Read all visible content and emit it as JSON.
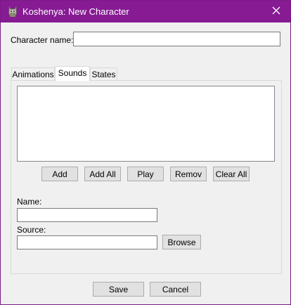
{
  "window": {
    "title": "Koshenya: New Character",
    "app_icon": "koshenya-cat-icon",
    "close_icon": "close-icon",
    "accent_color": "#861b93"
  },
  "character": {
    "name_label": "Character name:",
    "name_value": ""
  },
  "tabs": [
    {
      "label": "Animations",
      "active": false
    },
    {
      "label": "Sounds",
      "active": true
    },
    {
      "label": "States",
      "active": false
    }
  ],
  "sounds_tab": {
    "sounds_list": [],
    "buttons": {
      "add": "Add",
      "add_all": "Add All",
      "play": "Play",
      "remove": "Remov",
      "clear_all": "Clear All"
    },
    "name_label": "Name:",
    "name_value": "",
    "source_label": "Source:",
    "source_value": "",
    "browse_label": "Browse"
  },
  "footer": {
    "save_label": "Save",
    "cancel_label": "Cancel"
  }
}
